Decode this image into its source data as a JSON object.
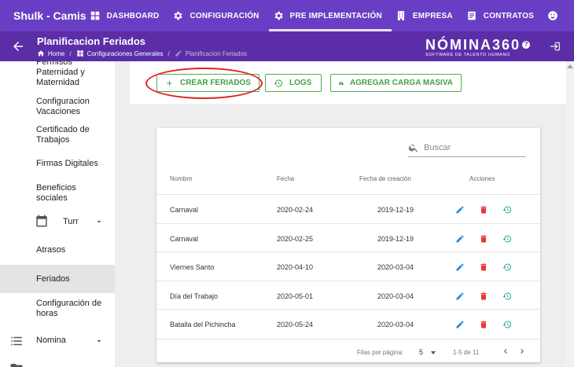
{
  "company": "Shulk - Camisas El",
  "topnav": [
    {
      "label": "DASHBOARD",
      "icon": "dashboard-icon"
    },
    {
      "label": "CONFIGURACIÓN",
      "icon": "gear-icon"
    },
    {
      "label": "PRE IMPLEMENTACIÓN",
      "icon": "gear-icon"
    },
    {
      "label": "EMPRESA",
      "icon": "building-icon"
    },
    {
      "label": "CONTRATOS",
      "icon": "contract-icon"
    }
  ],
  "header": {
    "title": "Planificacion Feriados",
    "breadcrumb": [
      "Home",
      "Configuraciones Generales",
      "Planificacion Feriados"
    ],
    "logo": "NÓMINA360",
    "logo_question": "?",
    "logo_tagline": "SOFTWARE DE TALENTO HUMANO"
  },
  "sidebar": {
    "items": [
      {
        "label": "Permisos Paternidad y Maternidad"
      },
      {
        "label": "Configuracion Vacaciones"
      },
      {
        "label": "Certificado de Trabajos"
      },
      {
        "label": "Firmas Digitales"
      },
      {
        "label": "Beneficios sociales"
      },
      {
        "label": "Turr",
        "icon": "calendar-icon"
      },
      {
        "label": "Atrasos"
      },
      {
        "label": "Feriados",
        "active": true
      },
      {
        "label": "Configuración de horas"
      },
      {
        "label": "Nomina",
        "icon": "list-icon"
      }
    ]
  },
  "toolbar": {
    "create_label": "CREAR FERIADOS",
    "logs_label": "LOGS",
    "bulk_label": "AGREGAR CARGA MASIVA"
  },
  "table": {
    "search_placeholder": "Buscar",
    "headers": {
      "name": "Nombre",
      "date": "Fecha",
      "created": "Fecha de creación",
      "actions": "Acciones"
    },
    "rows": [
      {
        "name": "Carnaval",
        "date": "2020-02-24",
        "created": "2019-12-19"
      },
      {
        "name": "Carnaval",
        "date": "2020-02-25",
        "created": "2019-12-19"
      },
      {
        "name": "Viernes Santo",
        "date": "2020-04-10",
        "created": "2020-03-04"
      },
      {
        "name": "Día del Trabajo",
        "date": "2020-05-01",
        "created": "2020-03-04"
      },
      {
        "name": "Batalla del Pichincha",
        "date": "2020-05-24",
        "created": "2020-03-04"
      }
    ],
    "rows_per_page_label": "Filas por página:",
    "rows_per_page": "5",
    "range": "1-5 de 11"
  },
  "colors": {
    "primary": "#6a3ec4",
    "secondary": "#5b2ea8",
    "success": "#4caf50",
    "edit": "#1e88e5",
    "delete": "#e53935",
    "history": "#26a69a"
  }
}
